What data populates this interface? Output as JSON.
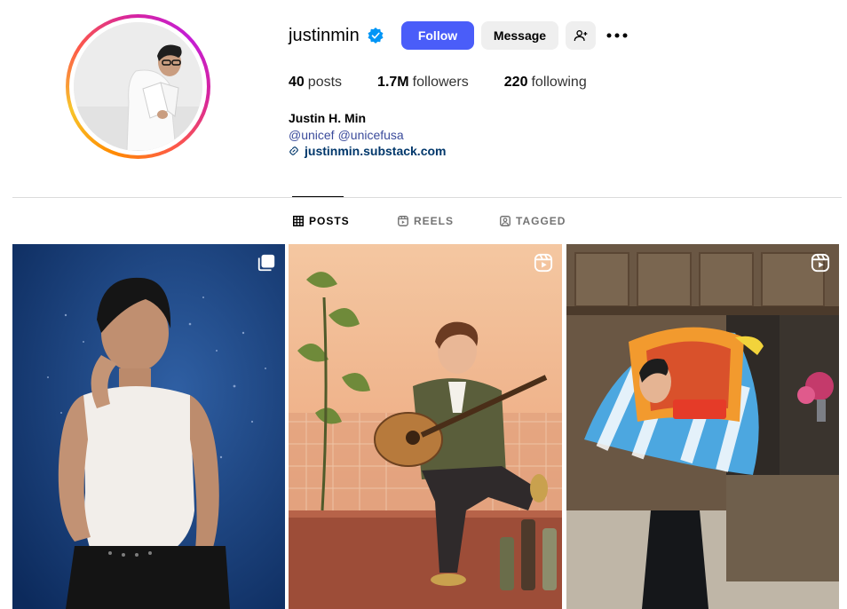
{
  "profile": {
    "username": "justinmin",
    "full_name": "Justin H. Min",
    "mentions": [
      "@unicef",
      "@unicefusa"
    ],
    "link": "justinmin.substack.com",
    "verified": true
  },
  "actions": {
    "follow": "Follow",
    "message": "Message"
  },
  "stats": [
    {
      "value": "40",
      "label": "posts"
    },
    {
      "value": "1.7M",
      "label": "followers"
    },
    {
      "value": "220",
      "label": "following"
    }
  ],
  "tabs": [
    {
      "label": "POSTS",
      "icon": "grid-icon",
      "active": true
    },
    {
      "label": "REELS",
      "icon": "reels-icon",
      "active": false
    },
    {
      "label": "TAGGED",
      "icon": "tagged-icon",
      "active": false
    }
  ],
  "posts": [
    {
      "type": "carousel",
      "badge_icon": "carousel-icon"
    },
    {
      "type": "reel",
      "badge_icon": "reel-icon"
    },
    {
      "type": "reel",
      "badge_icon": "reel-icon"
    }
  ],
  "colors": {
    "follow_button": "#4a5df9",
    "secondary_button": "#efefef",
    "verified_badge": "#0095f6",
    "link": "#00376b",
    "mention": "#3b4b9b"
  }
}
